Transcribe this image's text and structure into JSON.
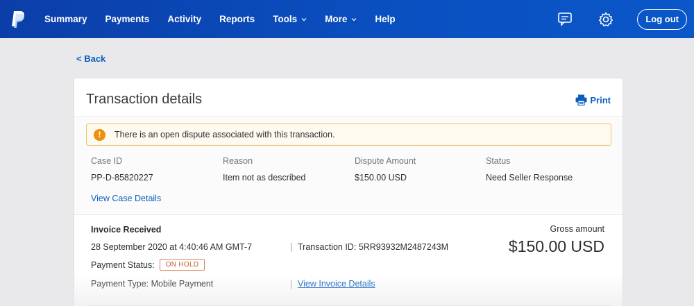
{
  "nav": {
    "items": [
      {
        "label": "Summary",
        "has_caret": false
      },
      {
        "label": "Payments",
        "has_caret": false
      },
      {
        "label": "Activity",
        "has_caret": false
      },
      {
        "label": "Reports",
        "has_caret": false
      },
      {
        "label": "Tools",
        "has_caret": true
      },
      {
        "label": "More",
        "has_caret": true
      },
      {
        "label": "Help",
        "has_caret": false
      }
    ],
    "icons": {
      "logo": "paypal-logo",
      "messages": "message-center-icon",
      "settings": "gear-icon"
    },
    "logout_label": "Log out",
    "color": "#0a4fc0"
  },
  "back_label": "< Back",
  "card": {
    "title": "Transaction details",
    "print_label": "Print",
    "alert": {
      "icon": "!",
      "text": "There is an open dispute associated with this transaction."
    },
    "dispute": {
      "case_id_label": "Case ID",
      "case_id": "PP-D-85820227",
      "reason_label": "Reason",
      "reason": "Item not as described",
      "amount_label": "Dispute Amount",
      "amount": "$150.00 USD",
      "status_label": "Status",
      "status": "Need Seller Response",
      "view_case_label": "View Case Details"
    },
    "invoice": {
      "title": "Invoice Received",
      "date": "28 September 2020 at 4:40:46 AM GMT-7",
      "transaction_id": "Transaction ID: 5RR93932M2487243M",
      "payment_status_label": "Payment Status:",
      "payment_status": "ON HOLD",
      "payment_type": "Payment Type: Mobile Payment",
      "view_invoice_label": "View Invoice Details",
      "gross_label": "Gross amount",
      "gross_amount": "$150.00 USD"
    }
  }
}
